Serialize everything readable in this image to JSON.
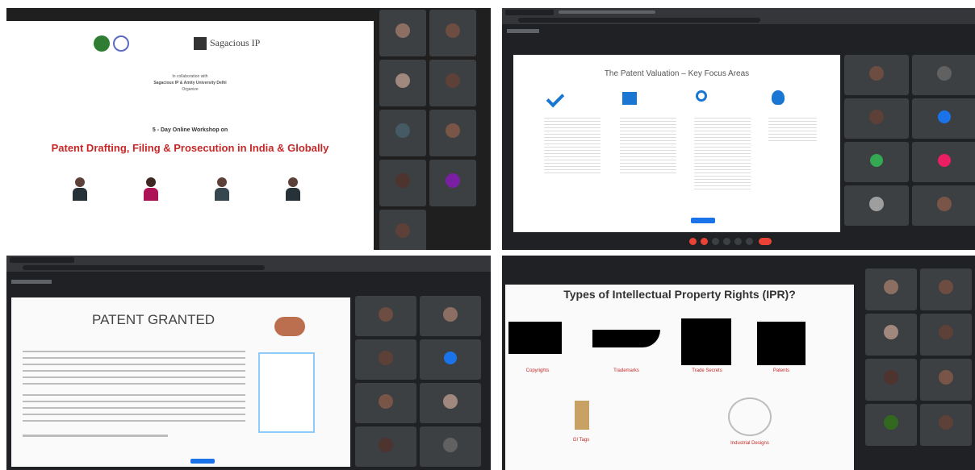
{
  "q1": {
    "partner_logo": "Sagacious IP",
    "intro_lines": [
      "In collaboration with",
      "Sagacious IP & Amity University Delhi",
      "Organize"
    ],
    "workshop": "5 - Day Online Workshop on",
    "title": "Patent Drafting, Filing & Prosecution in India & Globally",
    "tiles": [
      {
        "name": "",
        "color": "#8d6e63"
      },
      {
        "name": "",
        "color": "#6d4c41"
      },
      {
        "name": "",
        "color": "#a1887f"
      },
      {
        "name": "",
        "color": "#5d4037"
      },
      {
        "name": "",
        "color": "#455a64"
      },
      {
        "name": "",
        "color": "#795548"
      },
      {
        "name": "",
        "color": "#4e342e"
      },
      {
        "name": "",
        "color": "#7b1fa2"
      },
      {
        "name": "",
        "color": "#5d4037"
      }
    ]
  },
  "q2": {
    "slide_title": "The Patent Valuation – Key Focus Areas",
    "areas": [
      {
        "icon": "check-icon"
      },
      {
        "icon": "building-icon"
      },
      {
        "icon": "magnifier-icon"
      },
      {
        "icon": "head-icon"
      }
    ],
    "tiles": [
      {
        "name": "",
        "color": "#6d4c41",
        "avatar": false
      },
      {
        "name": "",
        "color": "#616161",
        "avatar": false
      },
      {
        "name": "",
        "color": "#5d4037",
        "avatar": false
      },
      {
        "name": "",
        "color": "#1a73e8",
        "avatar": true
      },
      {
        "name": "",
        "color": "#34a853",
        "avatar": true
      },
      {
        "name": "",
        "color": "#e91e63",
        "avatar": true
      },
      {
        "name": "",
        "color": "#9e9e9e",
        "avatar": false
      },
      {
        "name": "",
        "color": "#795548",
        "avatar": false
      }
    ]
  },
  "q3": {
    "slide_title": "PATENT GRANTED",
    "tiles": [
      {
        "name": "",
        "color": "#6d4c41",
        "avatar": false
      },
      {
        "name": "",
        "color": "#8d6e63",
        "avatar": false
      },
      {
        "name": "",
        "color": "#5d4037",
        "avatar": false
      },
      {
        "name": "",
        "color": "#1a73e8",
        "avatar": true
      },
      {
        "name": "",
        "color": "#795548",
        "avatar": false
      },
      {
        "name": "",
        "color": "#a1887f",
        "avatar": false
      },
      {
        "name": "",
        "color": "#4e342e",
        "avatar": false
      },
      {
        "name": "",
        "color": "#616161",
        "avatar": false
      }
    ]
  },
  "q4": {
    "slide_title": "Types of Intellectual Property Rights (IPR)?",
    "types": [
      {
        "label": "Copyrights",
        "icon": "masks-icon"
      },
      {
        "label": "Trademarks",
        "icon": "swoosh-icon"
      },
      {
        "label": "Trade Secrets",
        "icon": "lock-icon"
      },
      {
        "label": "Patents",
        "icon": "lightbulb-icon"
      },
      {
        "label": "GI Tags",
        "icon": "tag-icon"
      },
      {
        "label": "Industrial Designs",
        "icon": "design-icon"
      }
    ],
    "tiles": [
      {
        "name": "",
        "color": "#8d6e63"
      },
      {
        "name": "",
        "color": "#6d4c41"
      },
      {
        "name": "",
        "color": "#a1887f"
      },
      {
        "name": "",
        "color": "#5d4037"
      },
      {
        "name": "",
        "color": "#4e342e"
      },
      {
        "name": "",
        "color": "#795548"
      },
      {
        "name": "",
        "color": "#33691e"
      },
      {
        "name": "",
        "color": "#5d4037"
      }
    ]
  }
}
